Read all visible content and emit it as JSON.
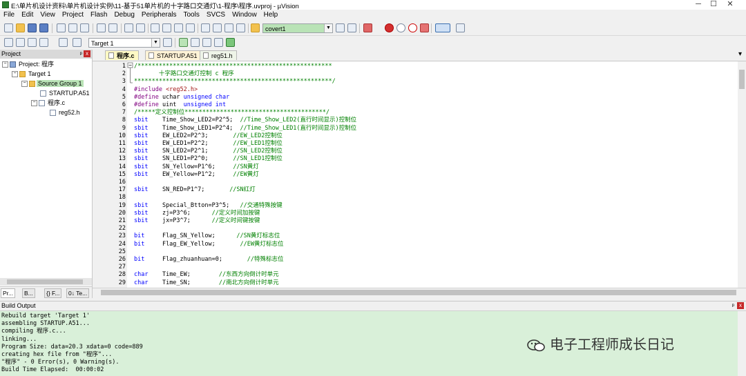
{
  "titlebar": {
    "title": "E:\\单片机设计资料\\单片机设计实例\\11-基于51单片机的十字路口交通灯\\1-程序\\程序.uvproj - µVision",
    "minimize": "─",
    "maximize": "☐",
    "close": "✕"
  },
  "menu": [
    "File",
    "Edit",
    "View",
    "Project",
    "Flash",
    "Debug",
    "Peripherals",
    "Tools",
    "SVCS",
    "Window",
    "Help"
  ],
  "toolbar": {
    "find_value": "covert1",
    "target_value": "Target 1"
  },
  "project_panel": {
    "title": "Project",
    "pin": "ᵖ",
    "close": "x",
    "tree": [
      {
        "label": "Project: 程序",
        "exp": "−"
      },
      {
        "label": "Target 1",
        "exp": "−"
      },
      {
        "label": "Source Group 1",
        "exp": "−"
      },
      {
        "label": "STARTUP.A51"
      },
      {
        "label": "程序.c",
        "exp": "−"
      },
      {
        "label": "reg52.h"
      }
    ],
    "tabs": [
      "Pr...",
      "B...",
      "{} F...",
      "0↓ Te..."
    ]
  },
  "editor": {
    "tabs": [
      "程序.c",
      "STARTUP.A51",
      "reg51.h"
    ],
    "menu_arrow": "▾"
  },
  "code": [
    {
      "n": "1",
      "t": [
        [
          "cm",
          "/*******************************************************"
        ]
      ]
    },
    {
      "n": "2",
      "t": [
        [
          "cm",
          "       十字路口交通灯控制 c 程序"
        ]
      ]
    },
    {
      "n": "3",
      "t": [
        [
          "cm",
          "********************************************************/"
        ]
      ]
    },
    {
      "n": "4",
      "t": [
        [
          "pp",
          "#include "
        ],
        [
          "st",
          "<reg52.h>"
        ]
      ]
    },
    {
      "n": "5",
      "t": [
        [
          "pp",
          "#define "
        ],
        [
          "",
          "uchar "
        ],
        [
          "kw",
          "unsigned char"
        ]
      ]
    },
    {
      "n": "6",
      "t": [
        [
          "pp",
          "#define "
        ],
        [
          "",
          "uint  "
        ],
        [
          "kw",
          "unsigned int"
        ]
      ]
    },
    {
      "n": "7",
      "t": [
        [
          "cm",
          "/*****定义控制位****************************************/"
        ]
      ]
    },
    {
      "n": "8",
      "t": [
        [
          "kw",
          "sbit"
        ],
        [
          "",
          "    Time_Show_LED2=P2^5;  "
        ],
        [
          "cm",
          "//Time_Show_LED2(直行时间显示)控制位"
        ]
      ]
    },
    {
      "n": "9",
      "t": [
        [
          "kw",
          "sbit"
        ],
        [
          "",
          "    Time_Show_LED1=P2^4;  "
        ],
        [
          "cm",
          "//Time_Show_LED1(直行时间显示)控制位"
        ]
      ]
    },
    {
      "n": "10",
      "t": [
        [
          "kw",
          "sbit"
        ],
        [
          "",
          "    EW_LED2=P2^3;       "
        ],
        [
          "cm",
          "//EW_LED2控制位"
        ]
      ]
    },
    {
      "n": "11",
      "t": [
        [
          "kw",
          "sbit"
        ],
        [
          "",
          "    EW_LED1=P2^2;       "
        ],
        [
          "cm",
          "//EW_LED1控制位"
        ]
      ]
    },
    {
      "n": "12",
      "t": [
        [
          "kw",
          "sbit"
        ],
        [
          "",
          "    SN_LED2=P2^1;       "
        ],
        [
          "cm",
          "//SN_LED2控制位"
        ]
      ]
    },
    {
      "n": "13",
      "t": [
        [
          "kw",
          "sbit"
        ],
        [
          "",
          "    SN_LED1=P2^0;       "
        ],
        [
          "cm",
          "//SN_LED1控制位"
        ]
      ]
    },
    {
      "n": "14",
      "t": [
        [
          "kw",
          "sbit"
        ],
        [
          "",
          "    SN_Yellow=P1^6;     "
        ],
        [
          "cm",
          "//SN黄灯"
        ]
      ]
    },
    {
      "n": "15",
      "t": [
        [
          "kw",
          "sbit"
        ],
        [
          "",
          "    EW_Yellow=P1^2;     "
        ],
        [
          "cm",
          "//EW黄灯"
        ]
      ]
    },
    {
      "n": "16",
      "t": [
        [
          "",
          ""
        ]
      ]
    },
    {
      "n": "17",
      "t": [
        [
          "kw",
          "sbit"
        ],
        [
          "",
          "    SN_RED=P1^7;       "
        ],
        [
          "cm",
          "//SN红灯"
        ]
      ]
    },
    {
      "n": "18",
      "t": [
        [
          "",
          ""
        ]
      ]
    },
    {
      "n": "19",
      "t": [
        [
          "kw",
          "sbit"
        ],
        [
          "",
          "    Special_Btton=P3^5;   "
        ],
        [
          "cm",
          "//交通特殊按键"
        ]
      ]
    },
    {
      "n": "20",
      "t": [
        [
          "kw",
          "sbit"
        ],
        [
          "",
          "    zj=P3^6;      "
        ],
        [
          "cm",
          "//定义时间加按键"
        ]
      ]
    },
    {
      "n": "21",
      "t": [
        [
          "kw",
          "sbit"
        ],
        [
          "",
          "    jx=P3^7;      "
        ],
        [
          "cm",
          "//定义时间键按键"
        ]
      ]
    },
    {
      "n": "22",
      "t": [
        [
          "",
          ""
        ]
      ]
    },
    {
      "n": "23",
      "t": [
        [
          "kw",
          "bit"
        ],
        [
          "",
          "     Flag_SN_Yellow;      "
        ],
        [
          "cm",
          "//SN黄灯标志位"
        ]
      ]
    },
    {
      "n": "24",
      "t": [
        [
          "kw",
          "bit"
        ],
        [
          "",
          "     Flag_EW_Yellow;       "
        ],
        [
          "cm",
          "//EW黄灯标志位"
        ]
      ]
    },
    {
      "n": "25",
      "t": [
        [
          "",
          ""
        ]
      ]
    },
    {
      "n": "26",
      "t": [
        [
          "kw",
          "bit"
        ],
        [
          "",
          "     Flag_zhuanhuan=0;       "
        ],
        [
          "cm",
          "//特殊标志位"
        ]
      ]
    },
    {
      "n": "27",
      "t": [
        [
          "",
          ""
        ]
      ]
    },
    {
      "n": "28",
      "t": [
        [
          "kw",
          "char"
        ],
        [
          "",
          "    Time_EW;        "
        ],
        [
          "cm",
          "//东西方向倒计时单元"
        ]
      ]
    },
    {
      "n": "29",
      "t": [
        [
          "kw",
          "char"
        ],
        [
          "",
          "    Time_SN;        "
        ],
        [
          "cm",
          "//南北方向倒计时单元"
        ]
      ]
    }
  ],
  "build": {
    "title": "Build Output",
    "pin": "ᵖ",
    "close": "x",
    "lines": [
      "Rebuild target 'Target 1'",
      "assembling STARTUP.A51...",
      "compiling 程序.c...",
      "linking...",
      "Program Size: data=20.3 xdata=0 code=889",
      "creating hex file from \"程序\"...",
      "\"程序\" - 0 Error(s), 0 Warning(s).",
      "Build Time Elapsed:  00:00:02"
    ]
  },
  "watermark": {
    "text": "电子工程师成长日记"
  }
}
